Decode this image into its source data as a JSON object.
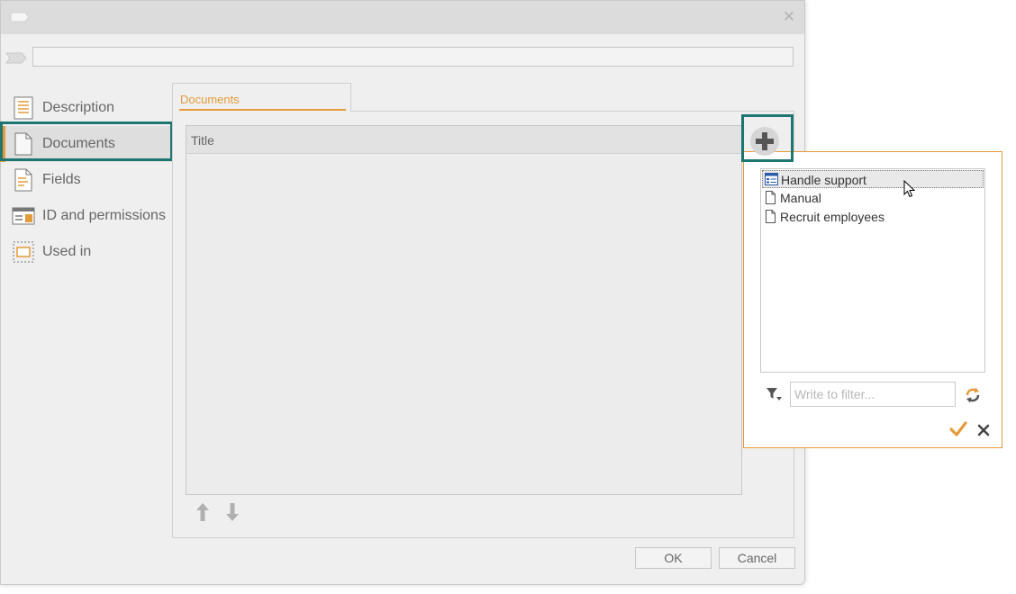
{
  "titlebar": {
    "close_glyph": "✕"
  },
  "nav": {
    "items": [
      {
        "label": "Description",
        "icon": "document-lines-icon"
      },
      {
        "label": "Documents",
        "icon": "document-icon"
      },
      {
        "label": "Fields",
        "icon": "document-fields-icon"
      },
      {
        "label": "ID and permissions",
        "icon": "id-card-icon"
      },
      {
        "label": "Used in",
        "icon": "used-in-icon"
      }
    ],
    "active_index": 1
  },
  "tab": {
    "label": "Documents"
  },
  "grid": {
    "column_title": "Title"
  },
  "footer": {
    "ok_label": "OK",
    "cancel_label": "Cancel"
  },
  "popup": {
    "items": [
      {
        "label": "Handle support",
        "icon": "form-icon",
        "selected": true
      },
      {
        "label": "Manual",
        "icon": "document-icon",
        "selected": false
      },
      {
        "label": "Recruit employees",
        "icon": "document-icon",
        "selected": false
      }
    ],
    "filter_placeholder": "Write to filter...",
    "filter_value": ""
  },
  "colors": {
    "accent": "#e39b3b",
    "highlight": "#1f7670"
  }
}
